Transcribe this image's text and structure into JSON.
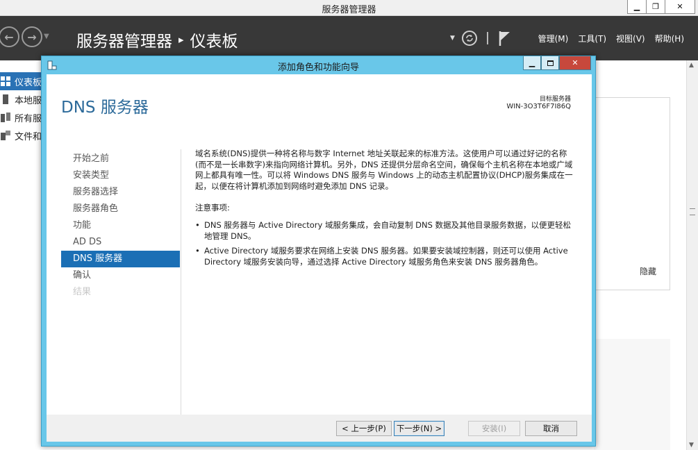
{
  "window": {
    "title": "服务器管理器",
    "min_glyph": "▁",
    "restore_glyph": "❐",
    "close_glyph": "✕"
  },
  "header": {
    "breadcrumb_app": "服务器管理器",
    "breadcrumb_sep": "▸",
    "breadcrumb_page": "仪表板",
    "menu": [
      "管理(M)",
      "工具(T)",
      "视图(V)",
      "帮助(H)"
    ]
  },
  "sidebar": {
    "items": [
      "仪表板",
      "本地服务器",
      "所有服务器",
      "文件和存储服务"
    ]
  },
  "background": {
    "hide_label": "隐藏"
  },
  "wizard": {
    "title": "添加角色和功能向导",
    "heading": "DNS 服务器",
    "target_label": "目标服务器",
    "target_value": "WIN-3O3T6F7I86Q",
    "nav": [
      "开始之前",
      "安装类型",
      "服务器选择",
      "服务器角色",
      "功能",
      "AD DS",
      "DNS 服务器",
      "确认",
      "结果"
    ],
    "description": "域名系统(DNS)提供一种将名称与数字 Internet 地址关联起来的标准方法。这使用户可以通过好记的名称(而不是一长串数字)来指向网络计算机。另外，DNS 还提供分层命名空间，确保每个主机名称在本地或广域网上都具有唯一性。可以将 Windows DNS 服务与 Windows 上的动态主机配置协议(DHCP)服务集成在一起，以便在将计算机添加到网络时避免添加 DNS 记录。",
    "notes_title": "注意事项:",
    "notes": [
      "DNS 服务器与 Active Directory 域服务集成，会自动复制 DNS 数据及其他目录服务数据，以便更轻松地管理 DNS。",
      "Active Directory 域服务要求在网络上安装 DNS 服务器。如果要安装域控制器，则还可以使用 Active Directory 域服务安装向导，通过选择 Active Directory 域服务角色来安装 DNS 服务器角色。"
    ],
    "buttons": {
      "prev": "< 上一步(P)",
      "next": "下一步(N) >",
      "install": "安装(I)",
      "cancel": "取消"
    }
  }
}
